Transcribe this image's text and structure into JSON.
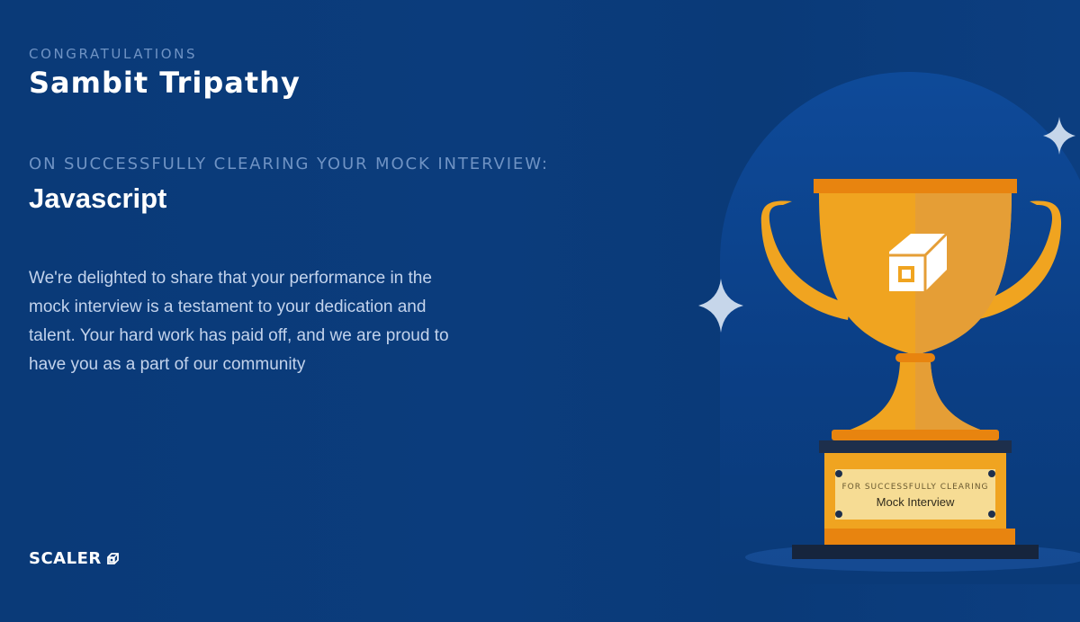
{
  "certificate": {
    "eyebrow": "CONGRATULATIONS",
    "recipient_name": "Sambit Tripathy",
    "subheading": "ON SUCCESSFULLY CLEARING YOUR MOCK INTERVIEW:",
    "subject": "Javascript",
    "message": "We're delighted to share that your performance in the mock interview is a testament to your dedication and talent. Your hard work has paid off, and we are proud to have you as a part of our community"
  },
  "brand": {
    "logo_text": "SCALER",
    "logo_icon": "scaler-cube-icon"
  },
  "trophy": {
    "plaque_line1": "FOR SUCCESSFULLY CLEARING",
    "plaque_line2": "Mock Interview",
    "icon": "trophy-icon"
  },
  "colors": {
    "background": "#0b3c7c",
    "muted_text": "#6f93c4",
    "trophy_gold": "#f0a420",
    "trophy_orange": "#e8840f"
  }
}
